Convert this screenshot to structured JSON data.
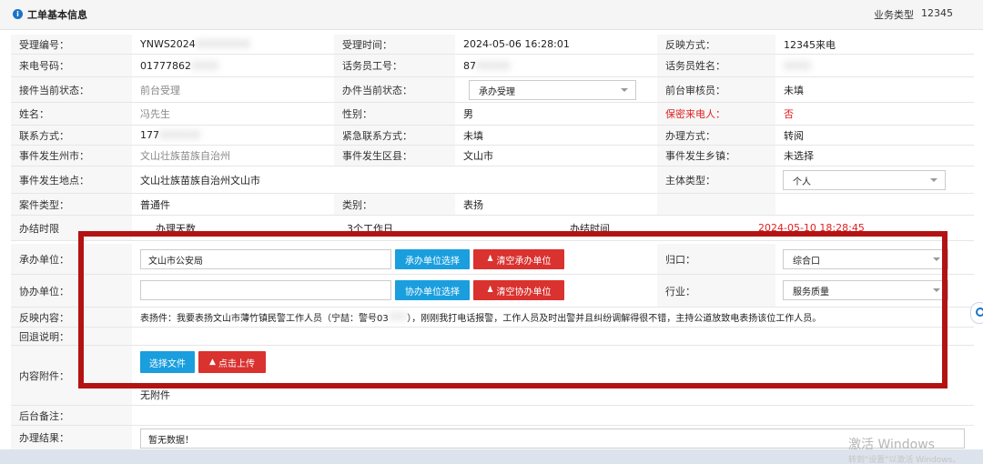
{
  "header": {
    "title": "工单基本信息",
    "biz_type_label": "业务类型",
    "biz_type_value": "12345"
  },
  "r1": {
    "accept_no_label": "受理编号：",
    "accept_no": "YNWS2024",
    "accept_time_label": "受理时间：",
    "accept_time": "2024-05-06 16:28:01",
    "reflect_label": "反映方式：",
    "reflect_value": "12345来电"
  },
  "r2": {
    "phone_label": "来电号码：",
    "phone": "01777862",
    "operator_no_label": "话务员工号：",
    "operator_no": "87",
    "operator_name_label": "话务员姓名："
  },
  "r3": {
    "cur_state_label": "接件当前状态：",
    "cur_state": "前台受理",
    "handle_state_label": "办件当前状态：",
    "handle_state": "承办受理",
    "reviewer_label": "前台审核员：",
    "reviewer": "未填"
  },
  "r4": {
    "name_label": "姓名：",
    "name": "冯先生",
    "gender_label": "性别：",
    "gender": "男",
    "secret_label": "保密来电人：",
    "secret": "否"
  },
  "r5": {
    "contact_label": "联系方式：",
    "contact": "177",
    "emergency_label": "紧急联系方式：",
    "emergency": "未填",
    "handle_mode_label": "办理方式：",
    "handle_mode": "转阅"
  },
  "r6": {
    "city_label": "事件发生州市：",
    "city": "文山壮族苗族自治州",
    "district_label": "事件发生区县：",
    "district": "文山市",
    "town_label": "事件发生乡镇：",
    "town": "未选择"
  },
  "r7": {
    "place_label": "事件发生地点：",
    "place": "文山壮族苗族自治州文山市",
    "subject_label": "主体类型：",
    "subject": "个人"
  },
  "r8": {
    "case_type_label": "案件类型：",
    "case_type": "普通件",
    "category_label": "类别：",
    "category": "表扬"
  },
  "r9": {
    "deadline_label": "办结时限",
    "work_days_label": "办理天数",
    "work_days": "3个工作日",
    "finish_time_label": "办结时间",
    "finish_time": "2024-05-10 18:28:45"
  },
  "r10": {
    "host_unit_label": "承办单位：",
    "host_unit": "文山市公安局",
    "host_select_btn": "承办单位选择",
    "host_clear_btn": "清空承办单位",
    "guikou_label": "归口：",
    "guikou": "综合口"
  },
  "r11": {
    "assist_unit_label": "协办单位：",
    "assist_unit": "",
    "assist_select_btn": "协办单位选择",
    "assist_clear_btn": "清空协办单位",
    "industry_label": "行业：",
    "industry": "服务质量"
  },
  "r12": {
    "content_label": "反映内容：",
    "content_a": "表扬件：我要表扬文山市薄竹镇民警工作人员（宁喆：警号03",
    "content_b": "），刚刚我打电话报警，工作人员及时出警并且纠纷调解得很不错，主持公道放致电表扬该位工作人员。"
  },
  "r13": {
    "return_label": "回退说明："
  },
  "r14": {
    "attach_label": "内容附件：",
    "choose_file_btn": "选择文件",
    "upload_btn": "点击上传",
    "no_attach": "无附件"
  },
  "r15": {
    "backend_note_label": "后台备注："
  },
  "r16": {
    "result_label": "办理结果：",
    "result": "暂无数据！"
  },
  "watermark": {
    "line1": "激活 Windows",
    "line2": "转到\"设置\"以激活 Windows。"
  },
  "colors": {
    "accent": "#1a9ede",
    "danger": "#d9322f",
    "highlight_border": "#b31313"
  }
}
